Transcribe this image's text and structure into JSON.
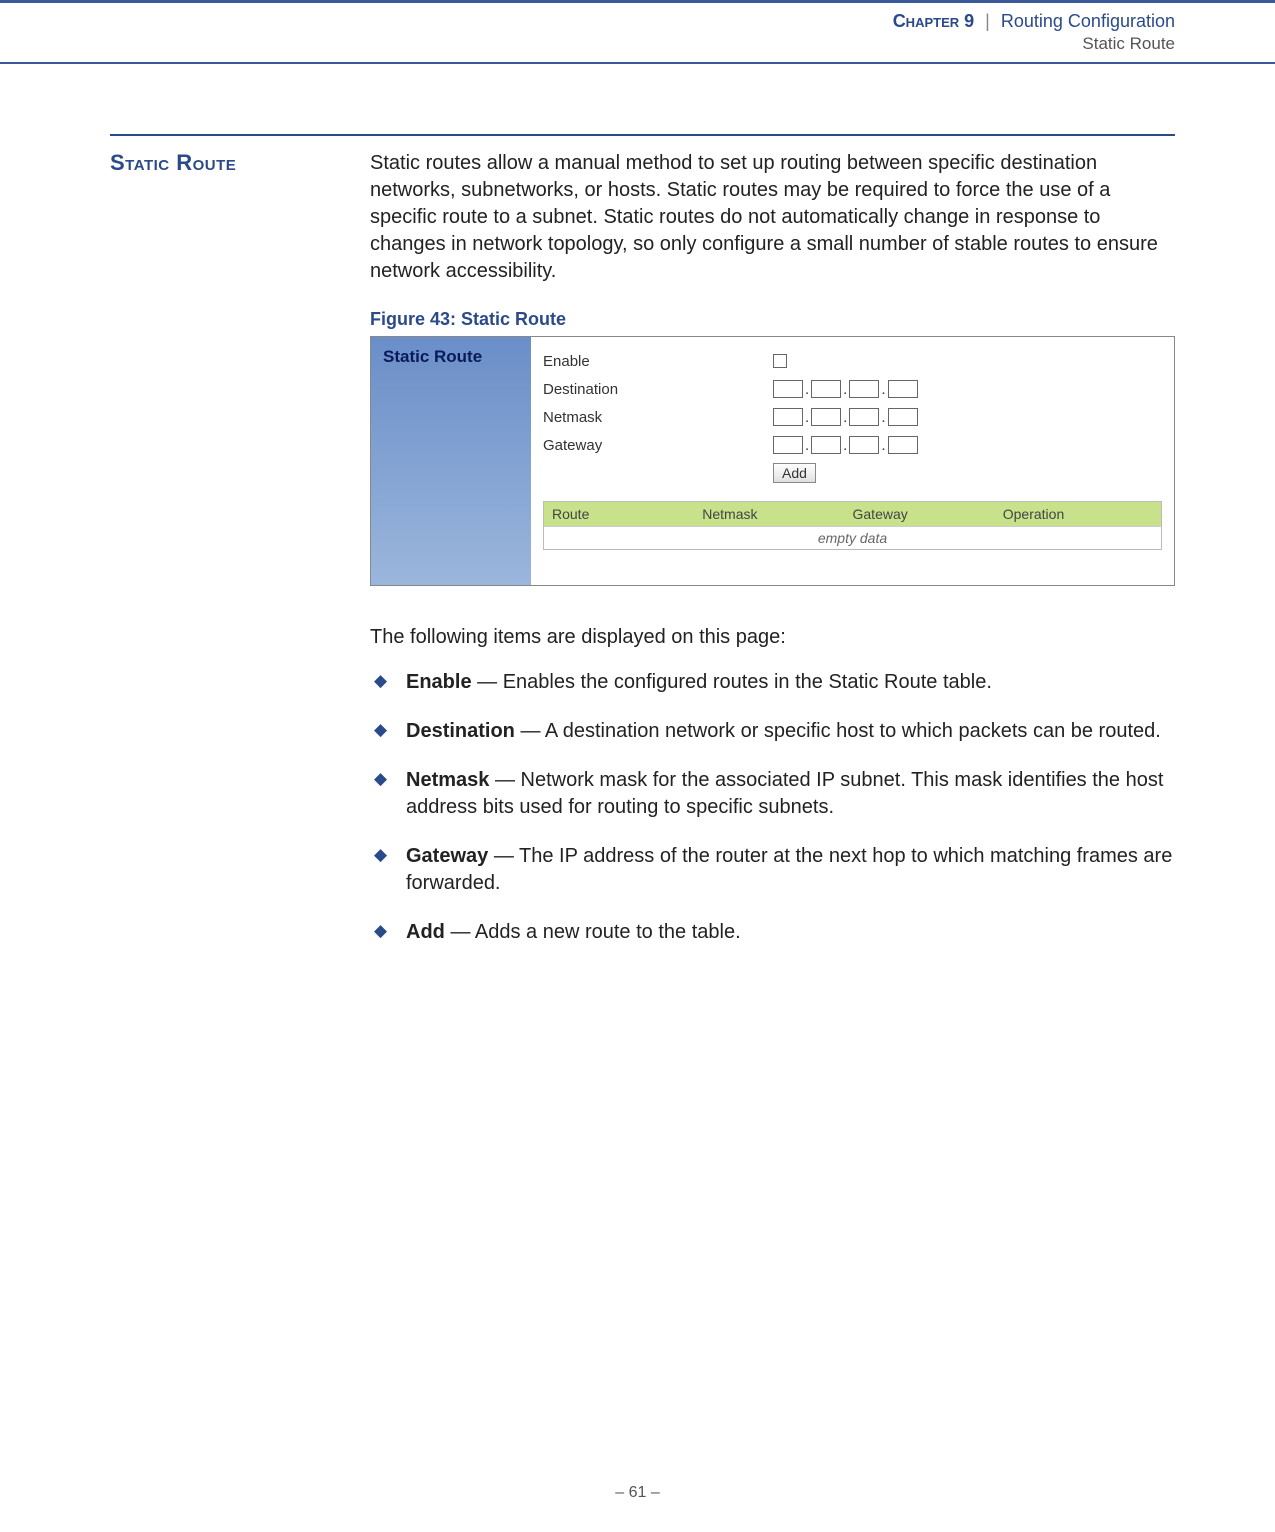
{
  "header": {
    "chapter_label": "Chapter 9",
    "separator": "|",
    "chapter_title": "Routing Configuration",
    "subtitle": "Static Route"
  },
  "section": {
    "heading": "Static Route",
    "intro": "Static routes allow a manual method to set up routing between specific destination networks, subnetworks, or hosts. Static routes may be required to force the use of a specific route to a subnet. Static routes do not automatically change in response to changes in network topology, so only configure a small number of stable routes to ensure network accessibility."
  },
  "figure": {
    "caption": "Figure 43:  Static Route",
    "sidebar_label": "Static Route",
    "form": {
      "enable": "Enable",
      "destination": "Destination",
      "netmask": "Netmask",
      "gateway": "Gateway",
      "add_button": "Add"
    },
    "table": {
      "headers": [
        "Route",
        "Netmask",
        "Gateway",
        "Operation"
      ],
      "empty": "empty data"
    }
  },
  "items_intro": "The following items are displayed on this page:",
  "items": [
    {
      "term": "Enable",
      "desc": " — Enables the configured routes in the Static Route table."
    },
    {
      "term": "Destination",
      "desc": " — A destination network or specific host to which packets can be routed."
    },
    {
      "term": "Netmask",
      "desc": " — Network mask for the associated IP subnet. This mask identifies the host address bits used for routing to specific subnets."
    },
    {
      "term": "Gateway",
      "desc": " — The IP address of the router at the next hop to which matching frames are forwarded."
    },
    {
      "term": "Add",
      "desc": " — Adds a new route to the table."
    }
  ],
  "footer": {
    "page": "–  61  –"
  }
}
